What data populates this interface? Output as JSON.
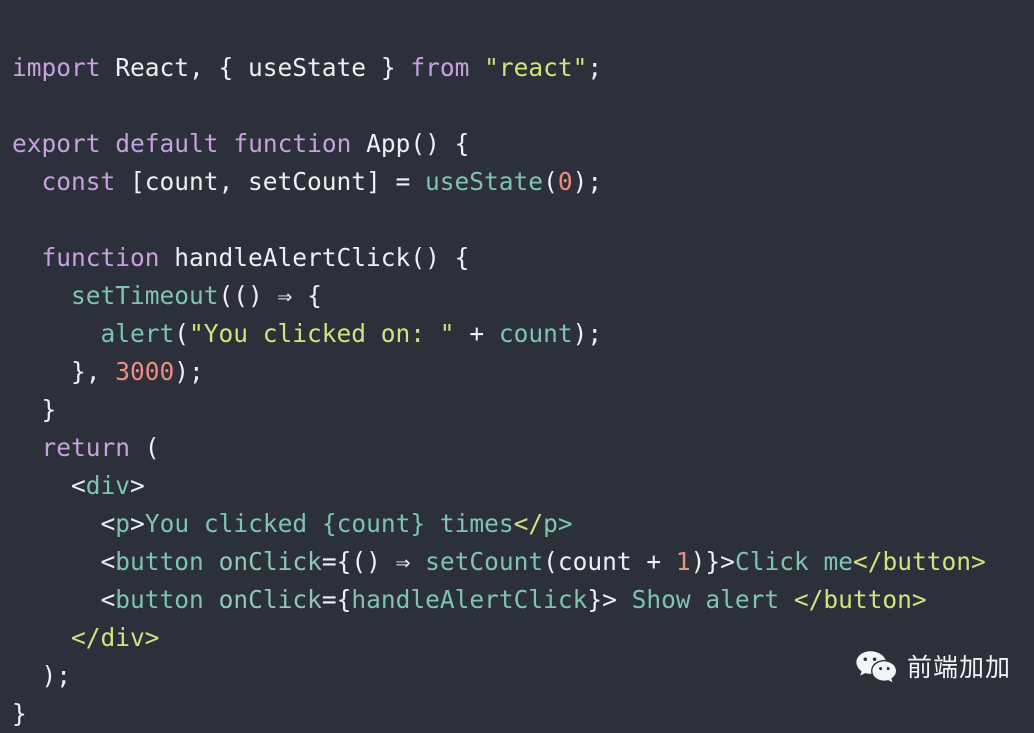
{
  "editor": {
    "background_color": "#2b303b",
    "foreground_color": "#eceff4",
    "language": "jsx",
    "font_size_px": 24,
    "line_height_px": 38,
    "total_lines": 18
  },
  "palette": {
    "keyword": "#c8a0e0",
    "string": "#d4e17d",
    "number": "#ef8b7f",
    "function": "#7fc4ae",
    "tag": "#7fc4ae",
    "plain": "#eceff4",
    "background": "#2b303b"
  },
  "code": {
    "lines": [
      "import React, { useState } from \"react\";",
      "",
      "export default function App() {",
      "  const [count, setCount] = useState(0);",
      "",
      "  function handleAlertClick() {",
      "    setTimeout(() => {",
      "      alert(\"You clicked on: \" + count);",
      "    }, 3000);",
      "  }",
      "  return (",
      "    <div>",
      "      <p>You clicked {count} times</p>",
      "      <button onClick={() => setCount(count + 1)}>Click me</button>",
      "      <button onClick={handleAlertClick}> Show alert </button>",
      "    </div>",
      "  );",
      "}"
    ],
    "tokens": {
      "l1": {
        "import": "import",
        "react_default": " React, ",
        "brace_open": "{ ",
        "useState": "useState",
        "brace_close": " } ",
        "from": "from",
        "space": " ",
        "module": "\"react\"",
        "semi": ";"
      },
      "l3": {
        "export": "export",
        "sp1": " ",
        "default": "default",
        "sp2": " ",
        "function": "function",
        "sp3": " ",
        "name": "App",
        "parens": "() {"
      },
      "l4": {
        "indent": "  ",
        "const": "const",
        "destructure": " [count, setCount] = ",
        "call": "useState",
        "open": "(",
        "zero": "0",
        "close": ");"
      },
      "l6": {
        "indent": "  ",
        "function": "function",
        "sp": " ",
        "name": "handleAlertClick",
        "tail": "() {"
      },
      "l7": {
        "indent": "    ",
        "call": "setTimeout",
        "open": "(() ",
        "arrow": "⇒",
        "tail": " {"
      },
      "l8": {
        "indent": "      ",
        "call": "alert",
        "open": "(",
        "string": "\"You clicked on: \"",
        "plus": " + ",
        "count": "count",
        "close": ");"
      },
      "l9": {
        "indent": "    ",
        "brace": "}, ",
        "number": "3000",
        "close": ");"
      },
      "l10": {
        "indent": "  ",
        "brace": "}"
      },
      "l11": {
        "indent": "  ",
        "return": "return",
        "tail": " ("
      },
      "l12": {
        "indent": "    ",
        "lt": "<",
        "tag": "div",
        "gt": ">"
      },
      "l13": {
        "indent": "      ",
        "lt": "<",
        "tag": "p",
        "gt": ">",
        "text": "You clicked {count} times",
        "close_slash": "</",
        "close_tag": "p",
        "close_gt": ">"
      },
      "l14": {
        "indent": "      ",
        "lt": "<",
        "tag": "button",
        "sp": " ",
        "attr": "onClick",
        "eq": "={() ",
        "arrow": "⇒",
        "sp2": " ",
        "call": "setCount",
        "args_open": "(count + ",
        "one": "1",
        "args_close": ")}>",
        "text": "Click me",
        "close_slash": "</",
        "close_tag": "button",
        "close_gt": ">"
      },
      "l15": {
        "indent": "      ",
        "lt": "<",
        "tag": "button",
        "sp": " ",
        "attr": "onClick",
        "eq": "={",
        "handler": "handleAlertClick",
        "close_brace": "}>",
        "text": " Show alert ",
        "close_slash": "</",
        "close_tag": "button",
        "close_gt": ">"
      },
      "l16": {
        "indent": "    ",
        "close_slash": "</",
        "tag": "div",
        "gt": ">"
      },
      "l17": {
        "indent": "  ",
        "text": ");"
      },
      "l18": {
        "text": "}"
      }
    }
  },
  "watermark": {
    "icon_name": "wechat-logo-icon",
    "label": "前端加加",
    "icon_color": "#f2f4f7",
    "text_color": "#f2f4f7"
  }
}
